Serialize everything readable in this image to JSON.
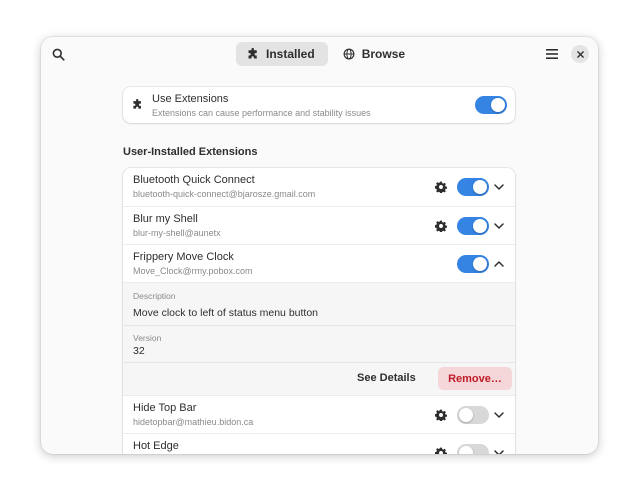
{
  "header": {
    "tabs": [
      {
        "label": "Installed",
        "active": true,
        "icon": "puzzle-icon"
      },
      {
        "label": "Browse",
        "active": false,
        "icon": "globe-icon"
      }
    ]
  },
  "master": {
    "title": "Use Extensions",
    "subtitle": "Extensions can cause performance and stability issues",
    "enabled": true
  },
  "section": {
    "title": "User-Installed Extensions"
  },
  "extensions": [
    {
      "name": "Bluetooth Quick Connect",
      "uuid": "bluetooth-quick-connect@bjarosze.gmail.com",
      "enabled": true,
      "has_settings": true,
      "expanded": false
    },
    {
      "name": "Blur my Shell",
      "uuid": "blur-my-shell@aunetx",
      "enabled": true,
      "has_settings": true,
      "expanded": false
    },
    {
      "name": "Frippery Move Clock",
      "uuid": "Move_Clock@rmy.pobox.com",
      "enabled": true,
      "has_settings": false,
      "expanded": true
    },
    {
      "name": "Hide Top Bar",
      "uuid": "hidetopbar@mathieu.bidon.ca",
      "enabled": false,
      "has_settings": true,
      "expanded": false
    },
    {
      "name": "Hot Edge",
      "uuid": "",
      "enabled": false,
      "has_settings": true,
      "expanded": false
    }
  ],
  "expanded_details": {
    "description_label": "Description",
    "description": "Move clock to left of status menu button",
    "version_label": "Version",
    "version": "32",
    "see_details_label": "See Details",
    "remove_label": "Remove…"
  },
  "colors": {
    "accent": "#3584e4",
    "destructive": "#c01c28",
    "destructive_bg": "#f6d7d9"
  }
}
